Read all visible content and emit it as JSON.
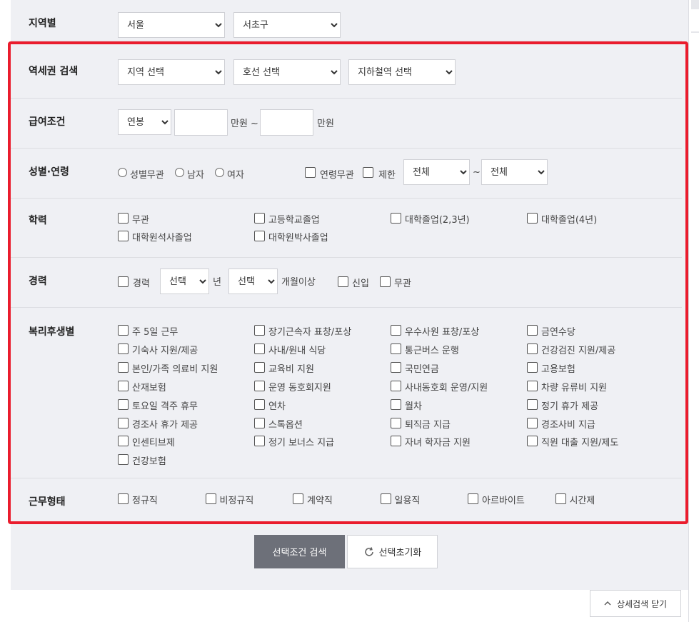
{
  "region": {
    "label": "지역별",
    "city_select": "서울",
    "district_select": "서초구"
  },
  "station": {
    "label": "역세권 검색",
    "region_select": "지역 선택",
    "line_select": "호선 선택",
    "station_select": "지하철역 선택"
  },
  "salary": {
    "label": "급여조건",
    "type_select": "연봉",
    "unit_from": "만원 ~",
    "unit_to": "만원"
  },
  "gender_age": {
    "label": "성별·연령",
    "genders": [
      "성별무관",
      "남자",
      "여자"
    ],
    "age_any": "연령무관",
    "age_limit": "제한",
    "age_from": "전체",
    "age_sep": "~",
    "age_to": "전체"
  },
  "education": {
    "label": "학력",
    "options": [
      "무관",
      "고등학교졸업",
      "대학졸업(2,3년)",
      "대학졸업(4년)",
      "대학원석사졸업",
      "대학원박사졸업"
    ]
  },
  "career": {
    "label": "경력",
    "career_check": "경력",
    "years_select": "선택",
    "years_unit": "년",
    "months_select": "선택",
    "months_unit": "개월이상",
    "newbie": "신입",
    "any": "무관"
  },
  "welfare": {
    "label": "복리후생별",
    "options": [
      "주 5일 근무",
      "장기근속자 표창/포상",
      "우수사원 표창/포상",
      "금연수당",
      "기숙사 지원/제공",
      "사내/원내 식당",
      "통근버스 운행",
      "건강검진 지원/제공",
      "본인/가족 의료비 지원",
      "교육비 지원",
      "국민연금",
      "고용보험",
      "산재보험",
      "운영 동호회지원",
      "사내동호회 운영/지원",
      "차량 유류비 지원",
      "토요일 격주 휴무",
      "연차",
      "월차",
      "정기 휴가 제공",
      "경조사 휴가 제공",
      "스톡옵션",
      "퇴직금 지급",
      "경조사비 지급",
      "인센티브제",
      "정기 보너스 지급",
      "자녀 학자금 지원",
      "직원 대출 지원/제도",
      "건강보험"
    ]
  },
  "work_type": {
    "label": "근무형태",
    "options": [
      "정규직",
      "비정규직",
      "계약직",
      "일용직",
      "아르바이트",
      "시간제"
    ]
  },
  "actions": {
    "search": "선택조건 검색",
    "reset": "선택초기화",
    "close": "상세검색 닫기"
  }
}
